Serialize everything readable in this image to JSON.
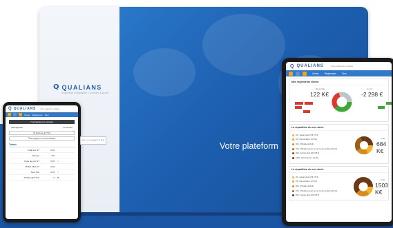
{
  "brand": {
    "name": "QUALIANS",
    "tagline_small": "Votre plateforme digitale",
    "tagline_large": "Votre plateform",
    "login_sub": "Expertise comptable • Conseil & Audit",
    "connect_label": "SE CONNECTER"
  },
  "phone": {
    "nav_items": [
      "Ventes",
      "Règlements",
      "Tiers"
    ],
    "primary_action": "✔ Enregistrer et remettre",
    "row_left": "Sauvegarder",
    "row_right": "⊘ Annuler",
    "options_btn": "⚙ Options de TVA",
    "model_btn": "☰ Enregistrer comme Modèle",
    "section": "Totaux",
    "lines": [
      {
        "label": "Total brut HT",
        "value": "0,00",
        "icon": ""
      },
      {
        "label": "Remise",
        "value": "0%",
        "icon": ""
      },
      {
        "label": "Frais de port HT",
        "value": "0,00",
        "icon": "⌕"
      },
      {
        "label": "TOTAL NET HT",
        "value": "0,00",
        "icon": ""
      },
      {
        "label": "Total TVA",
        "value": "0,00",
        "icon": "⌕"
      },
      {
        "label": "TOTAL NET TTC",
        "value": "0",
        "icon": "⊕"
      }
    ]
  },
  "tablet": {
    "nav_items": [
      "Ventes",
      "Règlements",
      "Tiers"
    ],
    "reglements": {
      "title": "Mes règlements clients",
      "left_label": "Disponible",
      "left_value": "122 K€",
      "right_label": "A venir",
      "right_value": "-2 298 €"
    },
    "repartition1": {
      "title": "La répartition de mes devis",
      "legend": [
        "0% - Suivant client (279 770 €)",
        "0% - Plan de financ. (175 k€)",
        "30% - Probable (213 k€)",
        "70% - Probable soit par mm de cte des produits (213 k€)",
        "90% - Soutien client (219 975 €)",
        "100% - Plan de financ. (km k€)"
      ],
      "total_label": "Total",
      "total_value": "684 K€"
    },
    "repartition2": {
      "title": "La répartition de mes devis",
      "legend": [
        "0% - Suivant client (279 770 €)",
        "0% - Plan de financ. (175 k€)",
        "30% - Probable (213 k€)",
        "70% - Probable soit par mm de cte des produits (213 k€)",
        "90% - Soutien client (219 975 €)"
      ],
      "total_label": "Total",
      "total_value": "1503 K€"
    }
  },
  "colors": {
    "brand_blue": "#1f5fb0",
    "accent_orange": "#f0a21b",
    "red": "#e0362c",
    "green": "#3aaa35",
    "brown": "#6b3a12"
  }
}
